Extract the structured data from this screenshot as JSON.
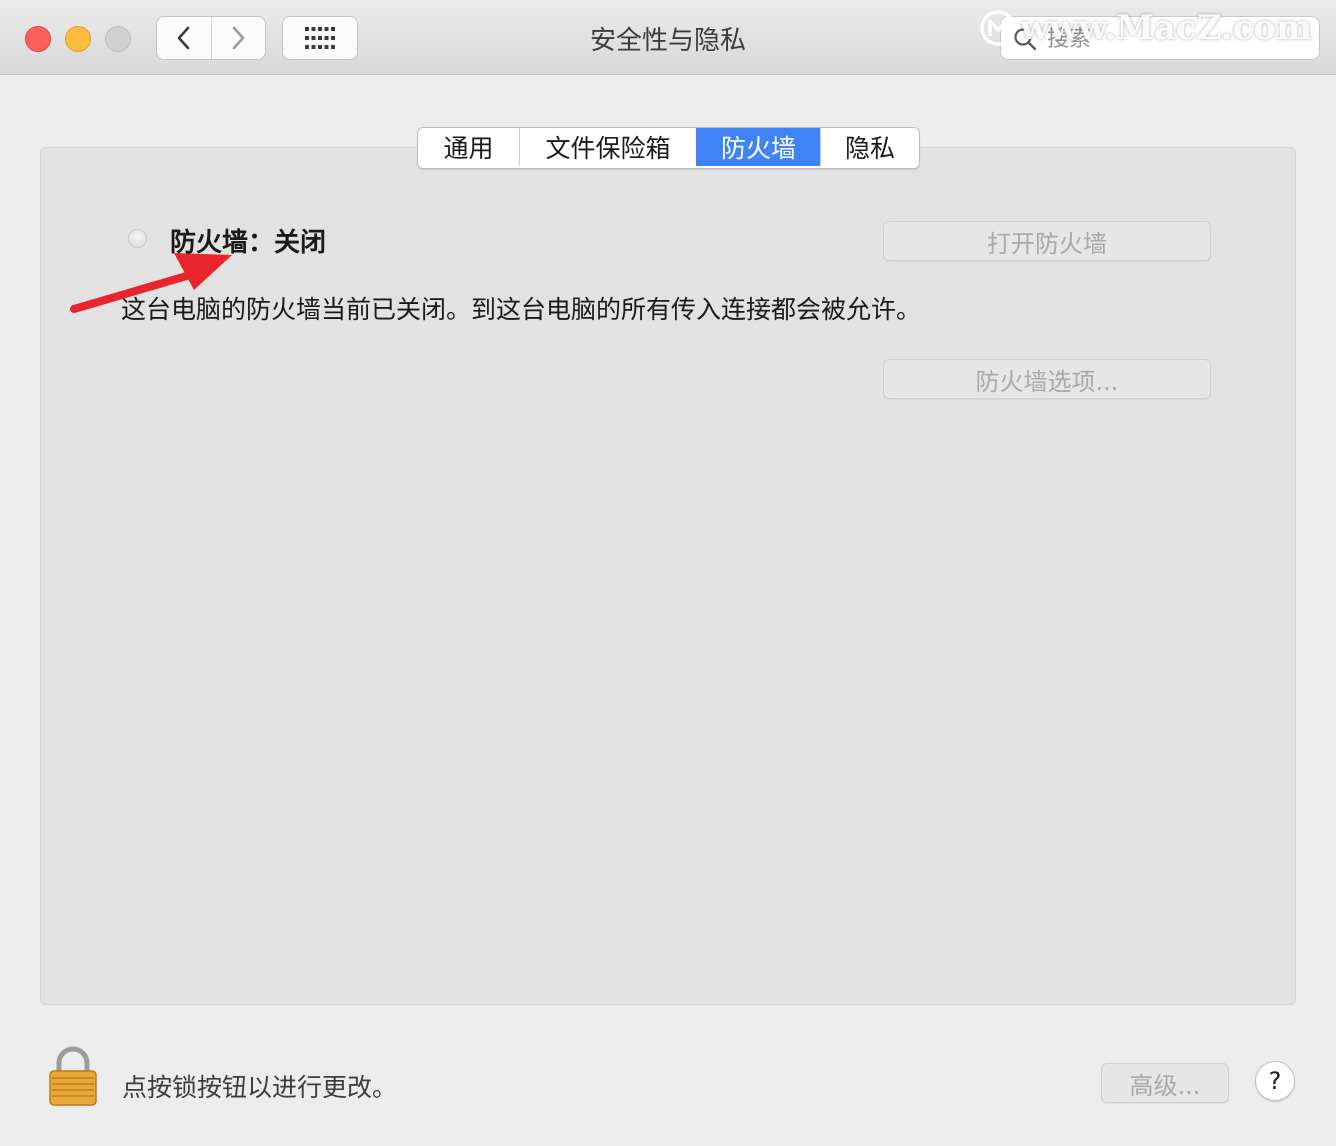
{
  "window": {
    "title": "安全性与隐私",
    "search_placeholder": "搜索",
    "watermark": "www.MacZ.com"
  },
  "icons": {
    "back": "chevron-left-icon",
    "forward": "chevron-right-icon",
    "grid": "grid-icon",
    "search": "search-icon",
    "lock": "lock-icon"
  },
  "tabs": [
    {
      "label": "通用",
      "active": false
    },
    {
      "label": "文件保险箱",
      "active": false
    },
    {
      "label": "防火墙",
      "active": true
    },
    {
      "label": "隐私",
      "active": false
    }
  ],
  "firewall": {
    "status_label": "防火墙：关闭",
    "description": "这台电脑的防火墙当前已关闭。到这台电脑的所有传入连接都会被允许。",
    "turn_on_button": "打开防火墙",
    "options_button": "防火墙选项..."
  },
  "footer": {
    "lock_text": "点按锁按钮以进行更改。",
    "advanced_button": "高级...",
    "help_label": "?"
  },
  "colors": {
    "accent": "#3f83f6",
    "annotation_arrow": "#e8242c",
    "close": "#fc605b",
    "minimize": "#fdbc40",
    "zoom_disabled": "#d0d0d0"
  }
}
